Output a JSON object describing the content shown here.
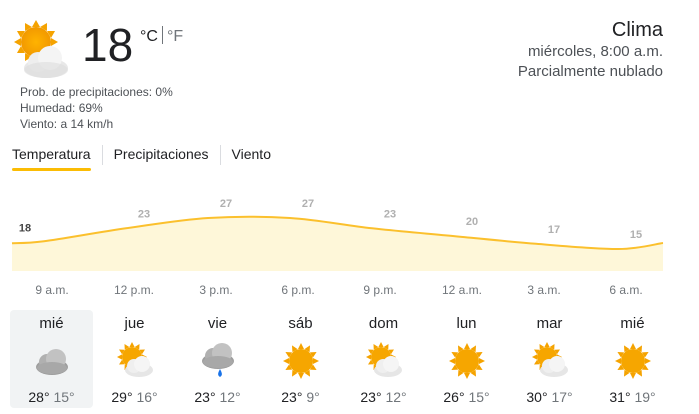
{
  "current": {
    "temperature": "18",
    "unit_c": "°C",
    "unit_f": "°F",
    "icon": "partly-cloudy-icon",
    "precipitation": "Prob. de precipitaciones: 0%",
    "humidity": "Humedad: 69%",
    "wind": "Viento: a 14 km/h"
  },
  "location": {
    "title": "Clima",
    "datetime": "miércoles, 8:00 a.m.",
    "condition": "Parcialmente nublado"
  },
  "tabs": [
    {
      "label": "Temperatura",
      "active": true
    },
    {
      "label": "Precipitaciones",
      "active": false
    },
    {
      "label": "Viento",
      "active": false
    }
  ],
  "chart_data": {
    "type": "area",
    "x": [
      "9 a.m.",
      "12 p.m.",
      "3 p.m.",
      "6 p.m.",
      "9 p.m.",
      "12 a.m.",
      "3 a.m.",
      "6 a.m."
    ],
    "values": [
      18,
      23,
      27,
      27,
      23,
      20,
      17,
      15
    ],
    "colors": {
      "line": "#fbc02d",
      "fill": "#fef7d9"
    }
  },
  "days": [
    {
      "name": "mié",
      "icon": "cloudy-icon",
      "high": "28°",
      "low": "15°",
      "selected": true
    },
    {
      "name": "jue",
      "icon": "partly-cloudy-icon",
      "high": "29°",
      "low": "16°",
      "selected": false
    },
    {
      "name": "vie",
      "icon": "rain-icon",
      "high": "23°",
      "low": "12°",
      "selected": false
    },
    {
      "name": "sáb",
      "icon": "sunny-icon",
      "high": "23°",
      "low": "9°",
      "selected": false
    },
    {
      "name": "dom",
      "icon": "partly-cloudy-icon",
      "high": "23°",
      "low": "12°",
      "selected": false
    },
    {
      "name": "lun",
      "icon": "sunny-icon",
      "high": "26°",
      "low": "15°",
      "selected": false
    },
    {
      "name": "mar",
      "icon": "partly-cloudy-icon",
      "high": "30°",
      "low": "17°",
      "selected": false
    },
    {
      "name": "mié",
      "icon": "sunny-icon",
      "high": "31°",
      "low": "19°",
      "selected": false
    }
  ]
}
